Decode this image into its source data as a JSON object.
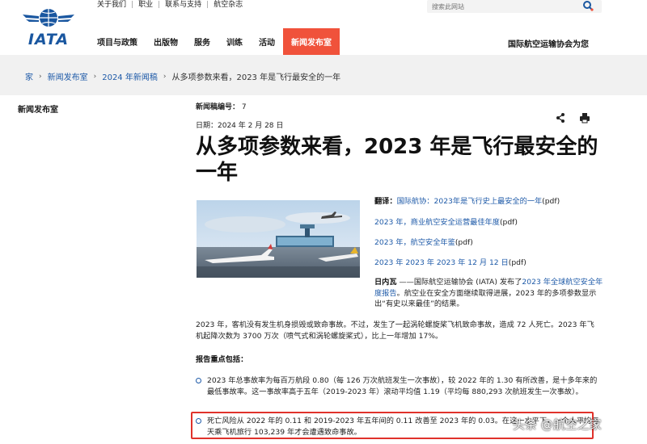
{
  "header": {
    "logo_text": "IATA",
    "util_nav": [
      "关于我们",
      "职业",
      "联系与支持",
      "航空杂志"
    ],
    "search_placeholder": "搜索此网站",
    "main_nav": [
      "项目与政策",
      "出版物",
      "服务",
      "训练",
      "活动",
      "新闻发布室"
    ],
    "active_nav": "新闻发布室",
    "right_link": "国际航空运输协会为您"
  },
  "breadcrumb": [
    "家",
    "新闻发布室",
    "2024 年新闻稿",
    "从多项参数来看，2023 年是飞行最安全的一年"
  ],
  "sidebar": {
    "title": "新闻发布室"
  },
  "article": {
    "release_label": "新闻稿编号：",
    "release_no": "7",
    "date": "日期：2024 年 2 月 28 日",
    "title": "从多项参数来看，2023 年是飞行最安全的一年",
    "translation_label": "翻译：",
    "links": [
      {
        "text": "国际航协：2023年是飞行史上最安全的一年",
        "suffix": "(pdf)"
      },
      {
        "text": "2023 年，商业航空安全运营最佳年度",
        "suffix": "(pdf)"
      },
      {
        "text": "2023 年，航空安全年鉴",
        "suffix": "(pdf)"
      },
      {
        "text": "2023 年 2023 年 2023 年 12 月 12 日",
        "suffix": "(pdf)"
      }
    ],
    "intro_bold": "日内瓦",
    "intro_pre": " ——国际航空运输协会 (IATA) 发布了",
    "intro_link": "2023 年全球航空安全年度报告",
    "intro_post": "。航空业在安全方面继续取得进展，2023 年的多项参数显示出“有史以来最佳”的结果。",
    "para2": "2023 年，客机没有发生机身损毁或致命事故。不过，发生了一起涡轮螺旋桨飞机致命事故，造成 72 人死亡。2023 年飞机起降次数为 3700 万次（喷气式和涡轮螺旋桨式），比上一年增加 17%。",
    "highlights_title": "报告重点包括：",
    "bullets": [
      "2023 年总事故率为每百万航段 0.80（每 126 万次航班发生一次事故），较 2022 年的 1.30 有所改善，是十多年来的最低事故率。这一事故率高于五年（2019-2023 年）滚动平均值 1.19（平均每 880,293 次航班发生一次事故）。",
      "死亡风险从 2022 年的 0.11 和 2019-2023 年五年间的 0.11 改善至 2023 年的 0.03。在这一水平下，一个人平均每天乘飞机旅行 103,239 年才会遭遇致命事故。"
    ]
  },
  "watermark": "头条 @航空之家",
  "colors": {
    "brand_blue": "#1a57a0",
    "active_nav": "#f0523b",
    "link": "#1e5aa8",
    "highlight_box": "#e0322b"
  }
}
